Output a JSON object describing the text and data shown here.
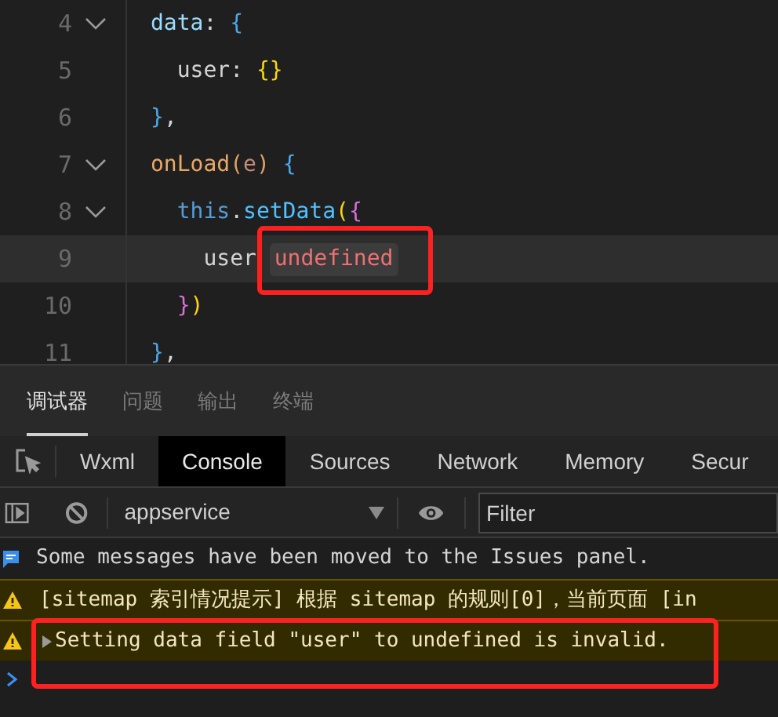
{
  "editor": {
    "lines": [
      {
        "number": "4",
        "foldable": true,
        "current": false,
        "tokens": [
          {
            "kind": "prop",
            "text": "data"
          },
          {
            "kind": "plain",
            "text": ": "
          },
          {
            "kind": "brace1",
            "text": "{"
          }
        ]
      },
      {
        "number": "5",
        "foldable": false,
        "current": false,
        "tokens": [
          {
            "kind": "plain",
            "text": "  user: "
          },
          {
            "kind": "brace2",
            "text": "{}"
          }
        ]
      },
      {
        "number": "6",
        "foldable": false,
        "current": false,
        "tokens": [
          {
            "kind": "brace1",
            "text": "}"
          },
          {
            "kind": "plain",
            "text": ","
          }
        ]
      },
      {
        "number": "7",
        "foldable": true,
        "current": false,
        "tokens": [
          {
            "kind": "func",
            "text": "onLoad"
          },
          {
            "kind": "brace3",
            "text": "("
          },
          {
            "kind": "param",
            "text": "e"
          },
          {
            "kind": "brace3",
            "text": ") "
          },
          {
            "kind": "brace1",
            "text": "{"
          }
        ]
      },
      {
        "number": "8",
        "foldable": true,
        "current": false,
        "tokens": [
          {
            "kind": "keyword",
            "text": "  this"
          },
          {
            "kind": "plain",
            "text": "."
          },
          {
            "kind": "method",
            "text": "setData"
          },
          {
            "kind": "brace2",
            "text": "("
          },
          {
            "kind": "brace4",
            "text": "{"
          }
        ]
      },
      {
        "number": "9",
        "foldable": false,
        "current": true,
        "tokens": [
          {
            "kind": "plain",
            "text": "    user "
          },
          {
            "kind": "hint",
            "text": "undefined"
          }
        ]
      },
      {
        "number": "10",
        "foldable": false,
        "current": false,
        "tokens": [
          {
            "kind": "brace4",
            "text": "  }"
          },
          {
            "kind": "brace2",
            "text": ")"
          }
        ]
      },
      {
        "number": "11",
        "foldable": false,
        "current": false,
        "tokens": [
          {
            "kind": "brace1",
            "text": "}"
          },
          {
            "kind": "plain",
            "text": ","
          }
        ]
      }
    ]
  },
  "panel_tabs": [
    {
      "label": "调试器",
      "selected": true
    },
    {
      "label": "问题",
      "selected": false
    },
    {
      "label": "输出",
      "selected": false
    },
    {
      "label": "终端",
      "selected": false
    }
  ],
  "devtools_tabs": [
    {
      "label": "Wxml",
      "selected": false
    },
    {
      "label": "Console",
      "selected": true
    },
    {
      "label": "Sources",
      "selected": false
    },
    {
      "label": "Network",
      "selected": false
    },
    {
      "label": "Memory",
      "selected": false
    },
    {
      "label": "Secur",
      "selected": false
    }
  ],
  "toolbar": {
    "context": "appservice",
    "filter": {
      "placeholder": "Filter"
    }
  },
  "console": [
    {
      "kind": "info",
      "text": "Some messages have been moved to the Issues panel.",
      "expandable": false
    },
    {
      "kind": "warning",
      "text": "[sitemap 索引情况提示] 根据 sitemap 的规则[0]，当前页面 [in",
      "expandable": false
    },
    {
      "kind": "warning",
      "text": "Setting data field \"user\" to undefined is invalid.",
      "expandable": true
    }
  ]
}
